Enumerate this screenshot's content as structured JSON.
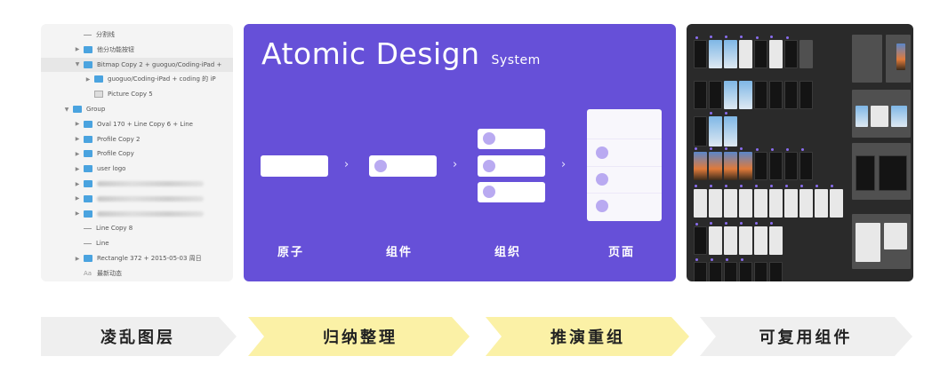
{
  "layers": {
    "rows": [
      {
        "label": "分割线",
        "type": "line",
        "indent": 2,
        "blur": false
      },
      {
        "label": "他分功能按钮",
        "type": "folder",
        "indent": 2,
        "blur": false
      },
      {
        "label": "Bitmap Copy 2 + guoguo/Coding-iPad +",
        "type": "folder",
        "indent": 2,
        "blur": false,
        "open": true,
        "selected": true
      },
      {
        "label": "guoguo/Coding-iPad + coding 的 iP",
        "type": "folder",
        "indent": 3,
        "blur": false
      },
      {
        "label": "Picture Copy 5",
        "type": "pic",
        "indent": 3,
        "blur": false
      },
      {
        "label": "Group",
        "type": "folder",
        "indent": 1,
        "blur": false,
        "open": true
      },
      {
        "label": "Oval 170 + Line Copy 6 + Line",
        "type": "folder",
        "indent": 2,
        "blur": false
      },
      {
        "label": "Profile Copy 2",
        "type": "folder",
        "indent": 2,
        "blur": false
      },
      {
        "label": "Profile Copy",
        "type": "folder",
        "indent": 2,
        "blur": false
      },
      {
        "label": "user logo",
        "type": "folder",
        "indent": 2,
        "blur": false
      },
      {
        "label": "",
        "type": "folder",
        "indent": 2,
        "blur": true
      },
      {
        "label": "",
        "type": "folder",
        "indent": 2,
        "blur": true
      },
      {
        "label": "",
        "type": "folder",
        "indent": 2,
        "blur": true
      },
      {
        "label": "Line Copy 8",
        "type": "line",
        "indent": 2,
        "blur": false
      },
      {
        "label": "Line",
        "type": "line",
        "indent": 2,
        "blur": false
      },
      {
        "label": "Rectangle 372 + 2015-05-03 周日",
        "type": "folder",
        "indent": 2,
        "blur": false
      },
      {
        "label": "最新动态",
        "type": "text",
        "indent": 2,
        "blur": false
      }
    ]
  },
  "atomic": {
    "title": "Atomic Design",
    "subtitle": "System",
    "stages": [
      "原子",
      "组件",
      "组织",
      "页面"
    ]
  },
  "process": {
    "steps": [
      {
        "label": "凌乱图层",
        "color": "#efefef"
      },
      {
        "label": "归纳整理",
        "color": "#fbf1a6"
      },
      {
        "label": "推演重组",
        "color": "#fbf1a6"
      },
      {
        "label": "可复用组件",
        "color": "#efefef"
      }
    ]
  },
  "colors": {
    "accent": "#6650d8",
    "board": "#2a2a2a",
    "folder": "#4aa3df"
  }
}
